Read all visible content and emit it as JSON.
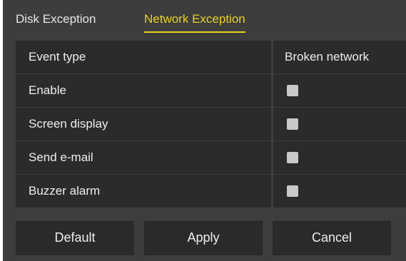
{
  "tabs": {
    "disk": "Disk Exception",
    "network": "Network Exception",
    "active": "network"
  },
  "table": {
    "header": {
      "label": "Event type",
      "value": "Broken network"
    },
    "rows": [
      {
        "label": "Enable",
        "checked": false
      },
      {
        "label": "Screen display",
        "checked": false
      },
      {
        "label": "Send e-mail",
        "checked": false
      },
      {
        "label": "Buzzer alarm",
        "checked": false
      }
    ]
  },
  "buttons": {
    "default": "Default",
    "apply": "Apply",
    "cancel": "Cancel"
  },
  "colors": {
    "background": "#3d3d3d",
    "cell": "#2b2b2b",
    "accent": "#e9d21c",
    "checkbox": "#c9c9c9"
  }
}
